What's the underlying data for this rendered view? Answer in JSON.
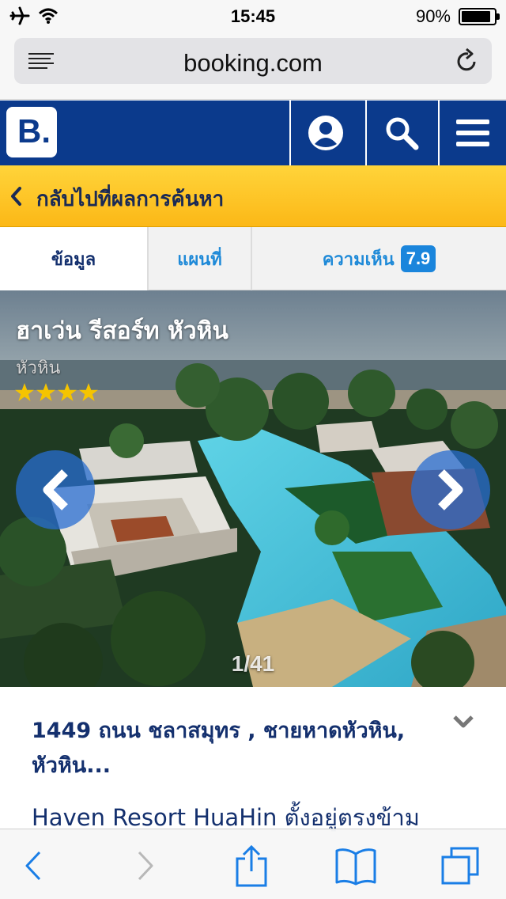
{
  "status_bar": {
    "time": "15:45",
    "battery": "90%",
    "battery_level": 0.9
  },
  "browser": {
    "url": "booking.com"
  },
  "header": {
    "logo_letter": "B."
  },
  "back_bar": {
    "label": "กลับไปที่ผลการค้นหา"
  },
  "tabs": [
    {
      "label": "ข้อมูล",
      "active": true
    },
    {
      "label": "แผนที่",
      "active": false
    },
    {
      "label": "ความเห็น",
      "active": false,
      "score": "7.9"
    }
  ],
  "hotel": {
    "name": "ฮาเว่น รีสอร์ท หัวหิน",
    "city": "หัวหิน",
    "stars": 4,
    "photo_counter": "1/41",
    "address_line1": "1449 ถนน ชลาสมุทร , ชายหาดหัวหิน,",
    "address_line2": "หัวหิน...",
    "description": "Haven Resort HuaHin ตั้งอยู่ตรงข้าม"
  },
  "colors": {
    "brand_blue": "#0b3a8c",
    "accent_yellow": "#fcb817",
    "link_blue": "#1f8ad8",
    "star": "#f5c400",
    "ios_blue": "#1a7ee6"
  }
}
